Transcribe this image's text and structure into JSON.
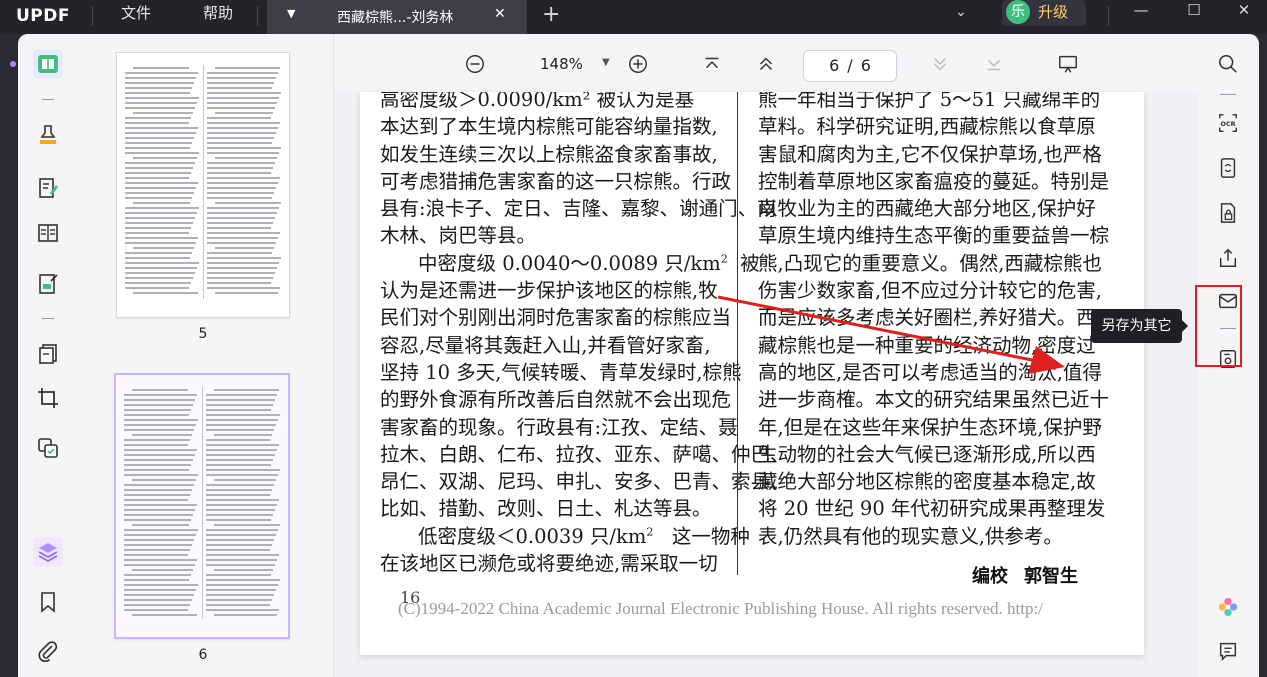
{
  "app": {
    "brand": "UPDF",
    "menu": [
      "文件",
      "帮助"
    ],
    "tab_title": "西藏棕熊...-刘务林",
    "upgrade_avatar": "乐",
    "upgrade_label": "升级"
  },
  "toolbar": {
    "zoom": "148%",
    "current_page": "6",
    "page_separator": "/",
    "total_pages": "6"
  },
  "thumbnails": [
    {
      "label": "5",
      "selected": false
    },
    {
      "label": "6",
      "selected": true
    }
  ],
  "document": {
    "left_column": [
      "高密度级＞0.0090/km² 被认为是基",
      "本达到了本生境内棕熊可能容纳量指数,",
      "如发生连续三次以上棕熊盗食家畜事故,",
      "可考虑猎捕危害家畜的这一只棕熊。行政",
      "县有:浪卡子、定日、吉隆、嘉黎、谢通门、南",
      "木林、岗巴等县。",
      "中密度级 0.0040～0.0089 只/km",
      "认为是还需进一步保护该地区的棕熊,牧",
      "民们对个别刚出洞时危害家畜的棕熊应当",
      "容忍,尽量将其轰赶入山,并看管好家畜,",
      "坚持 10 多天,气候转暖、青草发绿时,棕熊",
      "的野外食源有所改善后自然就不会出现危",
      "害家畜的现象。行政县有:江孜、定结、聂",
      "拉木、白朗、仁布、拉孜、亚东、萨噶、仲巴、",
      "昂仁、双湖、尼玛、申扎、安多、巴青、索县、",
      "比如、措勤、改则、日土、札达等县。",
      "低密度级＜0.0039 只/km",
      "在该地区已濒危或将要绝迹,需采取一切"
    ],
    "mid_density_tail": "被",
    "low_density_tail": "这一物种",
    "superscript": "2",
    "right_column": [
      "熊一年相当于保护了 5～51 只藏绵羊的",
      "草料。科学研究证明,西藏棕熊以食草原",
      "害鼠和腐肉为主,它不仅保护草场,也严格",
      "控制着草原地区家畜瘟疫的蔓延。特别是",
      "以牧业为主的西藏绝大部分地区,保护好",
      "草原生境内维持生态平衡的重要益兽一棕",
      "熊,凸现它的重要意义。偶然,西藏棕熊也",
      "伤害少数家畜,但不应过分计较它的危害,",
      "而是应该多考虑关好圈栏,养好猎犬。西",
      "藏棕熊也是一种重要的经济动物,密度过",
      "高的地区,是否可以考虑适当的淘汰,值得",
      "进一步商榷。本文的研究结果虽然已近十",
      "年,但是在这些年来保护生态环境,保护野",
      "生动物的社会大气候已逐渐形成,所以西",
      "藏绝大部分地区棕熊的密度基本稳定,故",
      "将 20 世纪 90 年代初研究成果再整理发",
      "表,仍然具有他的现实意义,供参考。"
    ],
    "editor_label": "编校",
    "editor_name": "郭智生",
    "page_number": "16",
    "copyright": "(C)1994-2022 China Academic Journal Electronic Publishing House. All rights reserved.    http:/"
  },
  "tooltip": "另存为其它",
  "colors": {
    "titlebar": "#23232a",
    "accent_purple": "#8f6bff",
    "highlight_red": "#e02020",
    "upgrade_text": "#ffcd6a"
  }
}
